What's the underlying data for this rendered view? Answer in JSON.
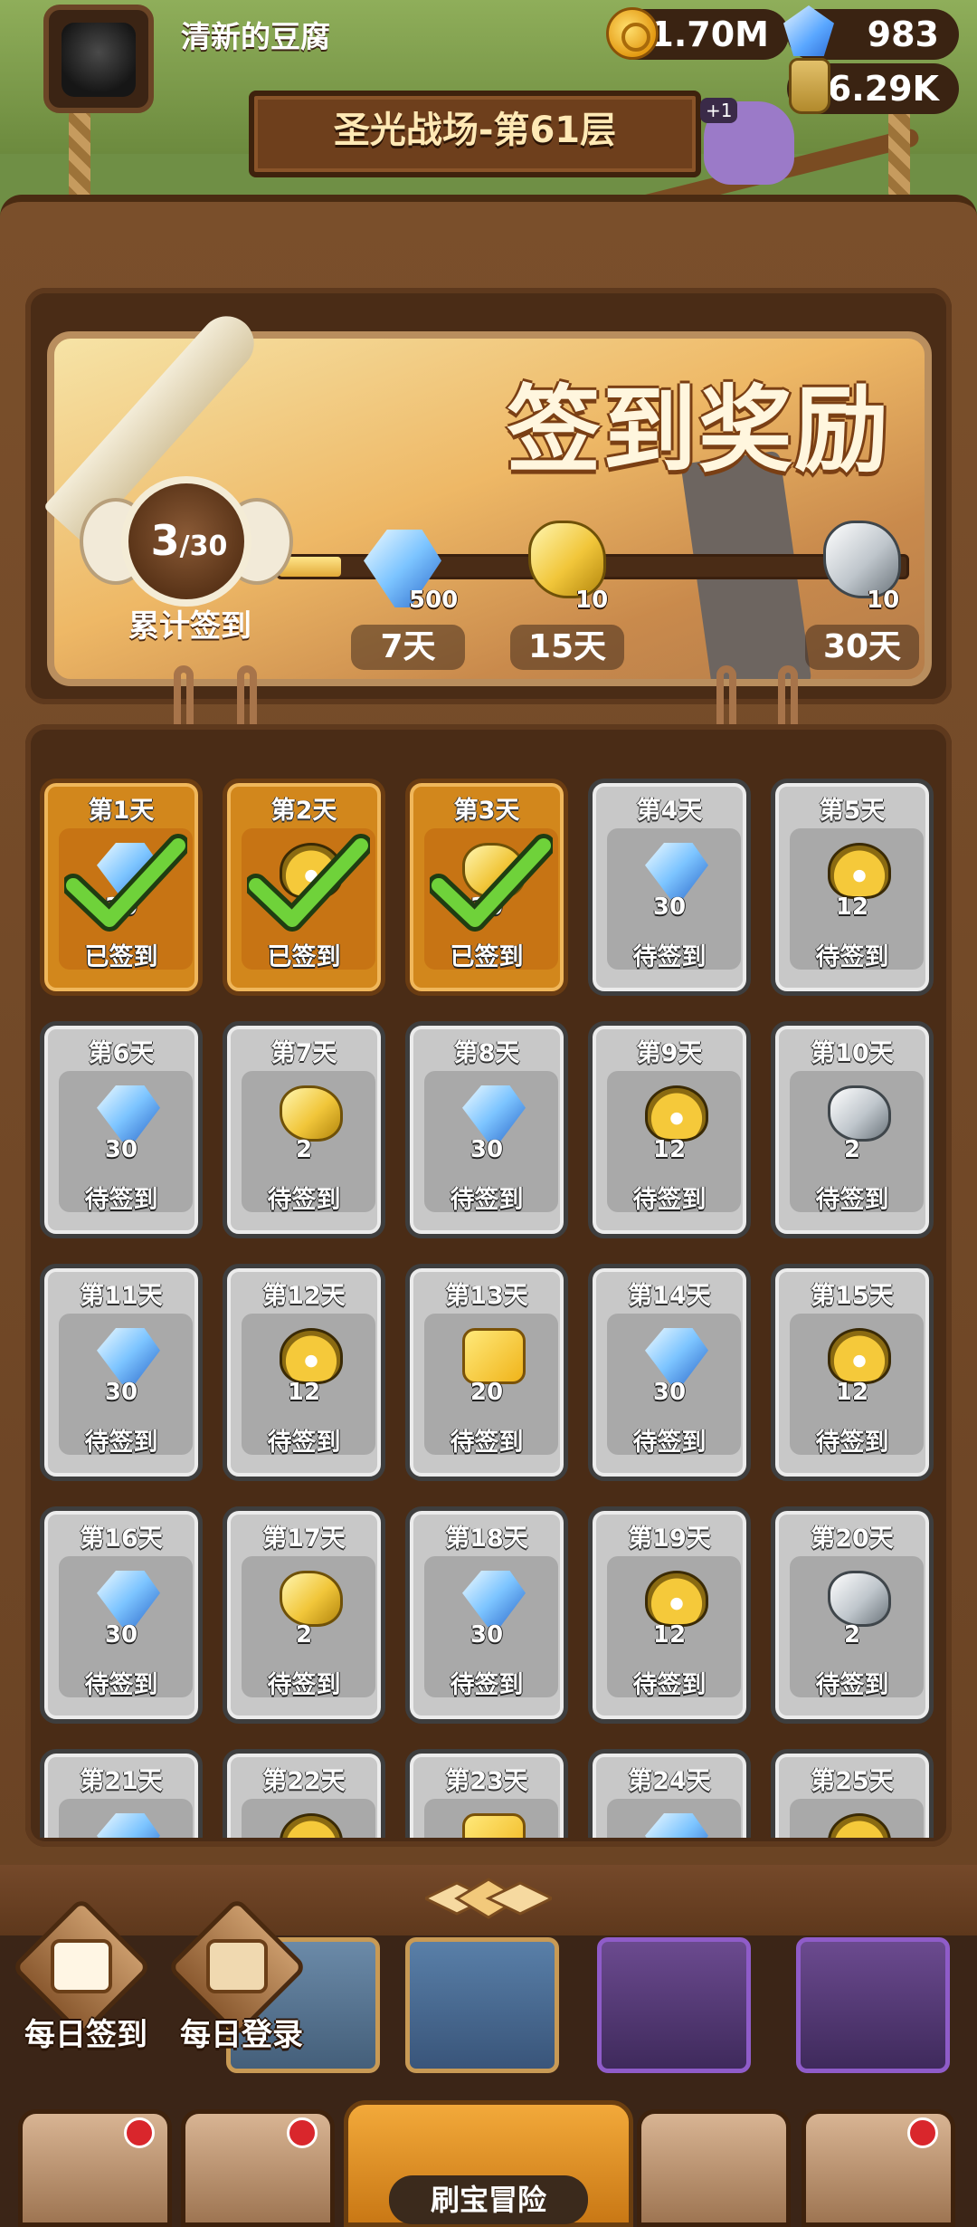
{
  "header": {
    "player_name": "清新的豆腐",
    "gold": "1.70M",
    "gems": "983",
    "scrolls": "6.29K",
    "stage_title": "圣光战场-第61层",
    "cat_tag": "+1"
  },
  "signin": {
    "title": "签到奖励",
    "count": "3",
    "total": "/30",
    "count_label": "累计签到",
    "progress_fraction": 0.1,
    "milestones": [
      {
        "day": "7天",
        "qty": "500",
        "icon": "gem-icon"
      },
      {
        "day": "15天",
        "qty": "10",
        "icon": "gold-scroll-icon"
      },
      {
        "day": "30天",
        "qty": "10",
        "icon": "silver-scroll-icon"
      }
    ]
  },
  "days": [
    {
      "day": "第1天",
      "qty": "30",
      "status": "已签到",
      "icon": "gem",
      "claimed": true
    },
    {
      "day": "第2天",
      "qty": "2",
      "status": "已签到",
      "icon": "hero",
      "claimed": true
    },
    {
      "day": "第3天",
      "qty": "30",
      "status": "已签到",
      "icon": "gold-scroll",
      "claimed": true
    },
    {
      "day": "第4天",
      "qty": "30",
      "status": "待签到",
      "icon": "gem",
      "claimed": false
    },
    {
      "day": "第5天",
      "qty": "12",
      "status": "待签到",
      "icon": "hero",
      "claimed": false
    },
    {
      "day": "第6天",
      "qty": "30",
      "status": "待签到",
      "icon": "gem",
      "claimed": false
    },
    {
      "day": "第7天",
      "qty": "2",
      "status": "待签到",
      "icon": "gold-scroll",
      "claimed": false
    },
    {
      "day": "第8天",
      "qty": "30",
      "status": "待签到",
      "icon": "gem",
      "claimed": false
    },
    {
      "day": "第9天",
      "qty": "12",
      "status": "待签到",
      "icon": "hero",
      "claimed": false
    },
    {
      "day": "第10天",
      "qty": "2",
      "status": "待签到",
      "icon": "silver-scroll",
      "claimed": false
    },
    {
      "day": "第11天",
      "qty": "30",
      "status": "待签到",
      "icon": "gem",
      "claimed": false
    },
    {
      "day": "第12天",
      "qty": "12",
      "status": "待签到",
      "icon": "hero",
      "claimed": false
    },
    {
      "day": "第13天",
      "qty": "20",
      "status": "待签到",
      "icon": "puzzle",
      "claimed": false
    },
    {
      "day": "第14天",
      "qty": "30",
      "status": "待签到",
      "icon": "gem",
      "claimed": false
    },
    {
      "day": "第15天",
      "qty": "12",
      "status": "待签到",
      "icon": "hero",
      "claimed": false
    },
    {
      "day": "第16天",
      "qty": "30",
      "status": "待签到",
      "icon": "gem",
      "claimed": false
    },
    {
      "day": "第17天",
      "qty": "2",
      "status": "待签到",
      "icon": "gold-scroll",
      "claimed": false
    },
    {
      "day": "第18天",
      "qty": "30",
      "status": "待签到",
      "icon": "gem",
      "claimed": false
    },
    {
      "day": "第19天",
      "qty": "12",
      "status": "待签到",
      "icon": "hero",
      "claimed": false
    },
    {
      "day": "第20天",
      "qty": "2",
      "status": "待签到",
      "icon": "silver-scroll",
      "claimed": false
    },
    {
      "day": "第21天",
      "qty": "",
      "status": "",
      "icon": "gem",
      "claimed": false
    },
    {
      "day": "第22天",
      "qty": "",
      "status": "",
      "icon": "hero",
      "claimed": false
    },
    {
      "day": "第23天",
      "qty": "",
      "status": "",
      "icon": "puzzle",
      "claimed": false
    },
    {
      "day": "第24天",
      "qty": "",
      "status": "",
      "icon": "gem",
      "claimed": false
    },
    {
      "day": "第25天",
      "qty": "",
      "status": "",
      "icon": "hero",
      "claimed": false
    }
  ],
  "side_buttons": {
    "daily_signin": "每日签到",
    "daily_login": "每日登录"
  },
  "nav": {
    "center_label": "刷宝冒险"
  }
}
